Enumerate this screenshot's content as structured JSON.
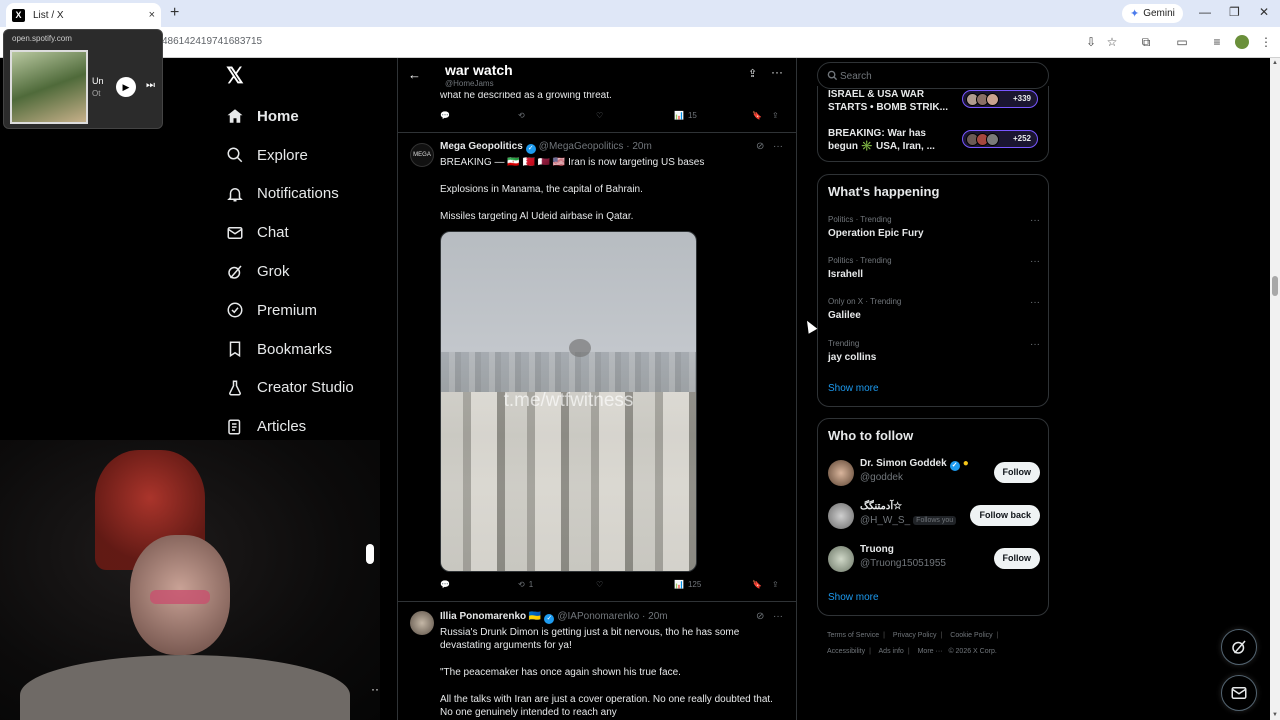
{
  "browser": {
    "tab_title": "List / X",
    "tab_favicon": "X",
    "new_tab": "+",
    "close_tab": "×",
    "gemini_label": "Gemini",
    "url": "486142419741683715"
  },
  "spotify_popup": {
    "host": "open.spotify.com",
    "track_title": "Un",
    "artist": "Ot"
  },
  "nav": {
    "items": [
      {
        "label": "Home",
        "icon": "home-icon"
      },
      {
        "label": "Explore",
        "icon": "search-icon"
      },
      {
        "label": "Notifications",
        "icon": "bell-icon"
      },
      {
        "label": "Chat",
        "icon": "mail-icon"
      },
      {
        "label": "Grok",
        "icon": "grok-icon"
      },
      {
        "label": "Premium",
        "icon": "premium-icon"
      },
      {
        "label": "Bookmarks",
        "icon": "bookmark-icon"
      },
      {
        "label": "Creator Studio",
        "icon": "flask-icon"
      },
      {
        "label": "Articles",
        "icon": "article-icon"
      }
    ]
  },
  "list": {
    "title": "war watch",
    "handle": "@HomeJams"
  },
  "prev_tweet": {
    "snippet": "what he described as a growing threat.",
    "views": "15"
  },
  "tweet1": {
    "name": "Mega Geopolitics",
    "handle": "@MegaGeopolitics",
    "time": "· 20m",
    "avatar_text": "MEGA",
    "line1": "BREAKING — 🇮🇷 🇧🇭 🇶🇦 🇺🇸 Iran is now targeting US bases",
    "line2": "Explosions in Manama, the capital of Bahrain.",
    "line3": "Missiles targeting Al Udeid airbase in Qatar.",
    "watermark": "t.me/wtfwitness",
    "retweets": "1",
    "views": "125"
  },
  "tweet2": {
    "name": "Illia Ponomarenko 🇺🇦",
    "handle": "@IAPonomarenko",
    "time": "· 20m",
    "line1": "Russia's Drunk Dimon is getting just a bit nervous, tho he has some devastating arguments for ya!",
    "line2": "\"The peacemaker has once again shown his true face.",
    "line3": "All the talks with Iran are just a cover operation. No one really doubted that. No one genuinely intended to reach any"
  },
  "sidebar": {
    "search_placeholder": "Search",
    "live": [
      {
        "text": "ISRAEL & USA WAR STARTS • BOMB STRIK...",
        "count": "+339"
      },
      {
        "text": "BREAKING: War has begun ✳️ USA, Iran, ...",
        "count": "+252"
      }
    ],
    "happening_title": "What's happening",
    "trends": [
      {
        "category": "Politics · Trending",
        "name": "Operation Epic Fury"
      },
      {
        "category": "Politics · Trending",
        "name": "Israhell"
      },
      {
        "category": "Only on X · Trending",
        "name": "Galilee"
      },
      {
        "category": "Trending",
        "name": "jay collins"
      }
    ],
    "show_more": "Show more",
    "who_to_follow_title": "Who to follow",
    "follows": [
      {
        "name": "Dr. Simon Goddek",
        "handle": "@goddek",
        "button": "Follow",
        "follows_you": ""
      },
      {
        "name": "آدمتنگگ☆",
        "handle": "@H_W_S_",
        "button": "Follow back",
        "follows_you": "Follows you"
      },
      {
        "name": "Truong",
        "handle": "@Truong15051955",
        "button": "Follow",
        "follows_you": ""
      }
    ],
    "show_more_follow": "Show more",
    "footer": [
      "Terms of Service",
      "Privacy Policy",
      "Cookie Policy",
      "Accessibility",
      "Ads info",
      "More ···",
      "© 2026 X Corp."
    ]
  },
  "colors": {
    "accent": "#1d9bf0",
    "background": "#000000",
    "border": "#2f3336",
    "muted": "#71767b"
  }
}
